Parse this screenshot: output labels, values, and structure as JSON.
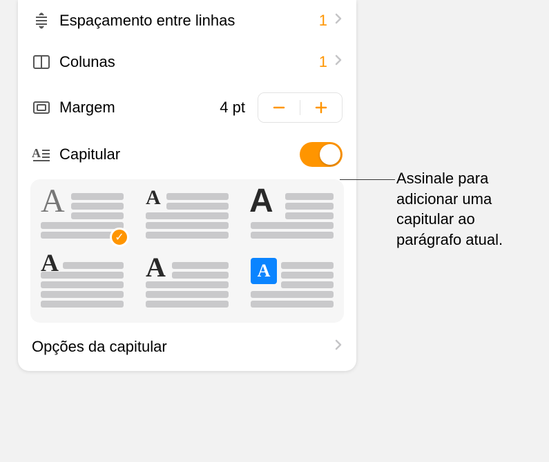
{
  "rows": {
    "line_spacing": {
      "label": "Espaçamento entre linhas",
      "value": "1"
    },
    "columns": {
      "label": "Colunas",
      "value": "1"
    },
    "margin": {
      "label": "Margem",
      "value": "4 pt"
    },
    "dropcap": {
      "label": "Capitular"
    }
  },
  "options_label": "Opções da capitular",
  "callout": "Assinale para adicionar uma capitular ao parágrafo atual."
}
